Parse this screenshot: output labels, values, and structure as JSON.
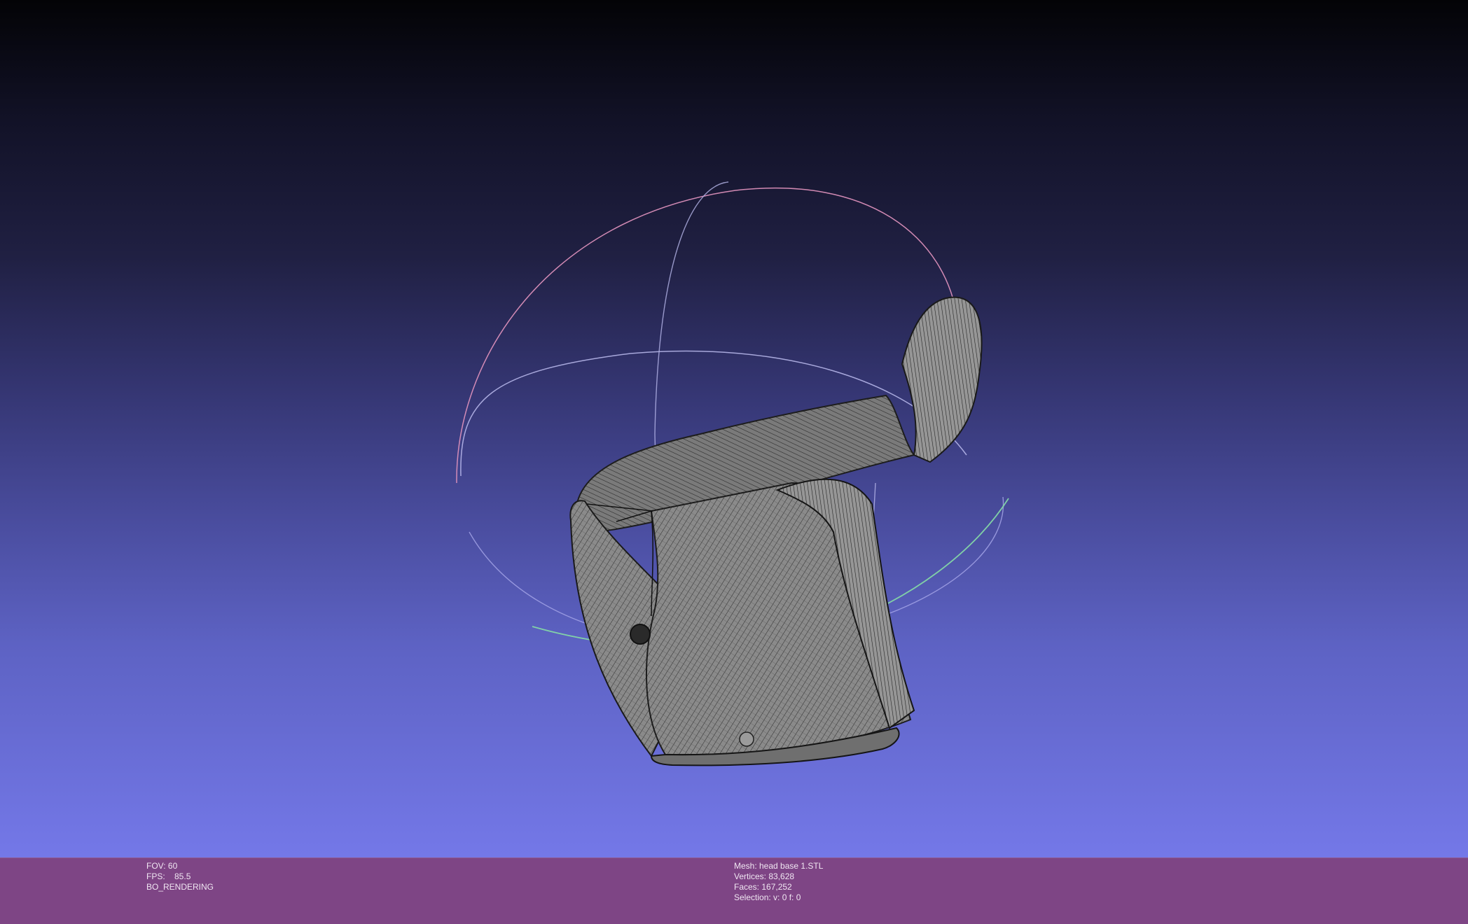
{
  "viewer": {
    "left_info": {
      "fov": "FOV: 60",
      "fps": "FPS:    85.5",
      "mode": "BO_RENDERING"
    },
    "right_info": {
      "mesh": "Mesh: head base 1.STL",
      "vertices": "Vertices: 83,628",
      "faces": "Faces: 167,252",
      "selection": "Selection: v: 0 f: 0"
    }
  },
  "colors": {
    "info_bar": "#7e4585",
    "mesh_fill": "#7c7c7c",
    "mesh_wire": "#2c2c2c",
    "trackball_red": "#d98db8",
    "trackball_blue": "#b6b7ea",
    "trackball_green": "#80d6a4"
  },
  "icons": {
    "trackball": "trackball-icon",
    "mesh": "mesh-icon"
  }
}
